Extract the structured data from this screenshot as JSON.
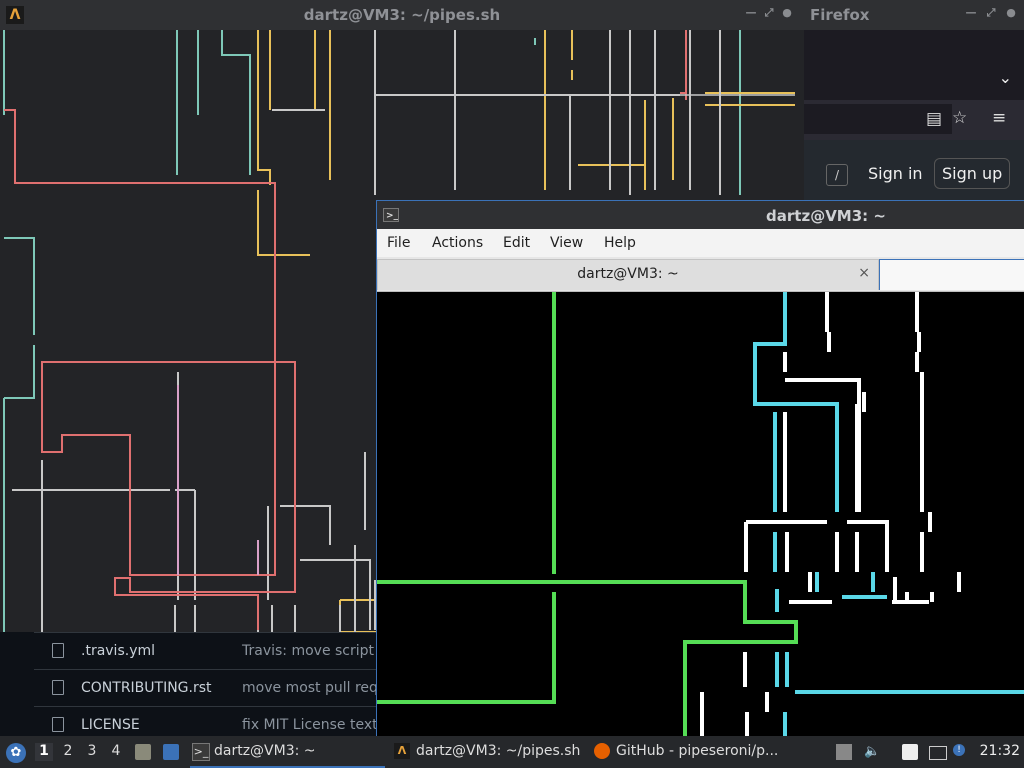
{
  "pipes_window": {
    "title": "dartz@VM3: ~/pipes.sh",
    "app_icon": "alacritty-icon",
    "buttons": [
      "minimize",
      "maximize",
      "close"
    ]
  },
  "firefox_window": {
    "title": "Firefox",
    "page": {
      "sign_in": "Sign in",
      "sign_up": "Sign up",
      "search_shortcut": "/"
    }
  },
  "github_files": [
    {
      "name": ".travis.yml",
      "message": "Travis: move script ph"
    },
    {
      "name": "CONTRIBUTING.rst",
      "message": "move most pull reque"
    },
    {
      "name": "LICENSE",
      "message": "fix MIT License text"
    }
  ],
  "terminal_window": {
    "title": "dartz@VM3: ~",
    "menu": [
      "File",
      "Actions",
      "Edit",
      "View",
      "Help"
    ],
    "tab_label": "dartz@VM3: ~",
    "tab_close": "×"
  },
  "taskbar": {
    "workspaces": [
      "1",
      "2",
      "3",
      "4"
    ],
    "active_workspace": "1",
    "tasks": [
      {
        "label": "dartz@VM3: ~",
        "icon": "terminal-icon",
        "active": true
      },
      {
        "label": "dartz@VM3: ~/pipes.sh",
        "icon": "alacritty-icon",
        "active": false
      },
      {
        "label": "GitHub - pipeseroni/p...",
        "icon": "firefox-icon",
        "active": false
      }
    ],
    "clock": "21:32"
  },
  "colors": {
    "pipe_teal": "#7ec8b8",
    "pipe_yellow": "#e8c15a",
    "pipe_red": "#e07070",
    "pipe_pink": "#d8a0c8",
    "pipe_gray": "#c8c8c8",
    "term_green": "#55dd55",
    "term_cyan": "#5ad8e8",
    "term_white": "#ffffff",
    "accent": "#3b72b8"
  }
}
